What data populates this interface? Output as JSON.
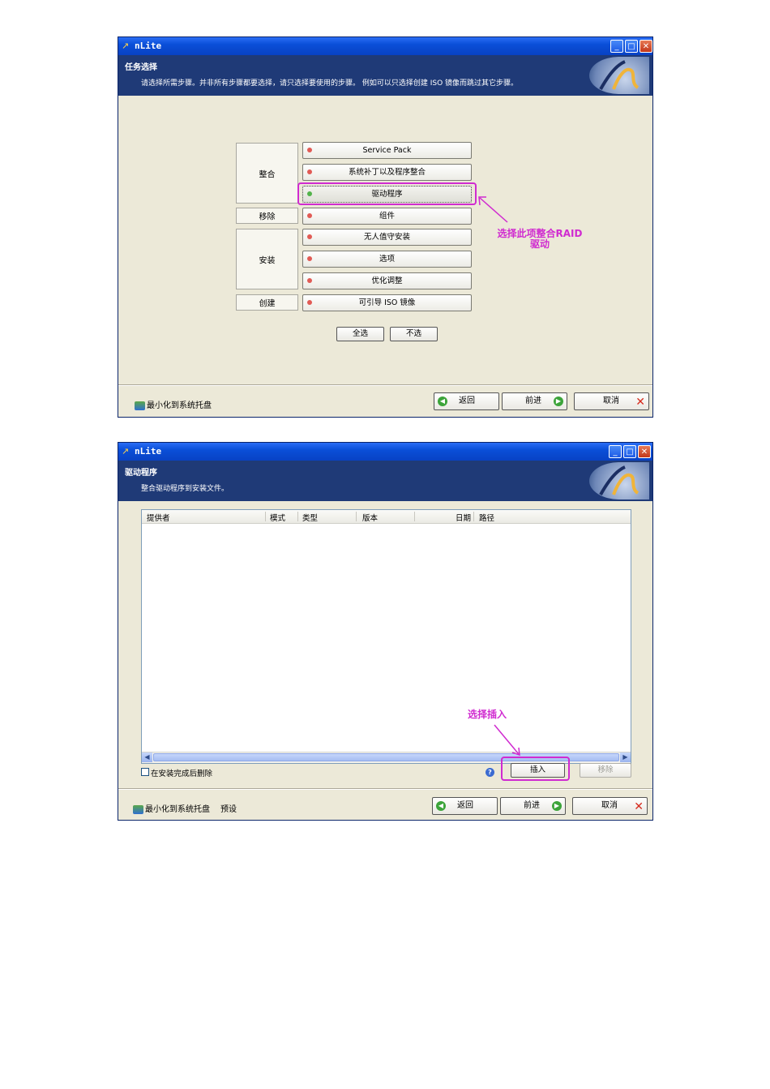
{
  "window1": {
    "title": "nLite",
    "header_title": "任务选择",
    "header_desc": "请选择所需步骤。并非所有步骤都要选择，请只选择要使用的步骤。 例如可以只选择创建 ISO 镜像而跳过其它步骤。",
    "groups": {
      "integrate": "整合",
      "remove": "移除",
      "setup": "安装",
      "create": "创建"
    },
    "tasks": {
      "service_pack": "Service Pack",
      "hotfixes": "系统补丁以及程序整合",
      "drivers": "驱动程序",
      "components": "组件",
      "unattended": "无人值守安装",
      "options": "选项",
      "tweaks": "优化调整",
      "bootable_iso": "可引导 ISO 镜像"
    },
    "select_all": "全选",
    "select_none": "不选",
    "tray": "最小化到系统托盘",
    "back": "返回",
    "next": "前进",
    "cancel": "取消",
    "annotation": "选择此项整合RAID 驱动"
  },
  "window2": {
    "title": "nLite",
    "header_title": "驱动程序",
    "header_desc": "整合驱动程序到安装文件。",
    "columns": [
      "提供者",
      "模式",
      "类型",
      "版本",
      "日期",
      "路径"
    ],
    "rows": [],
    "delete_after_install": "在安装完成后删除",
    "insert": "插入",
    "remove": "移除",
    "tray": "最小化到系统托盘",
    "preset": "预设",
    "back": "返回",
    "next": "前进",
    "cancel": "取消",
    "annotation": "选择插入"
  }
}
